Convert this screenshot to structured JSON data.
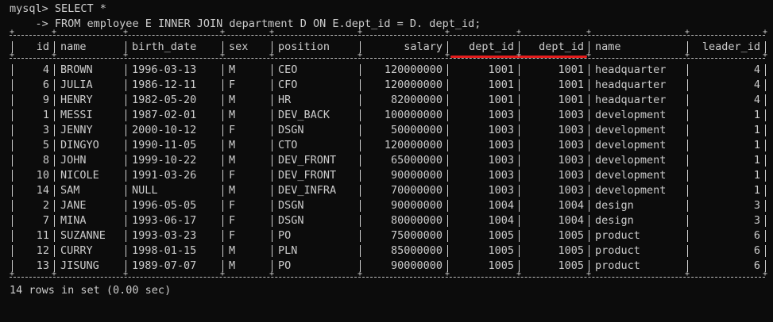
{
  "terminal": {
    "prompt": "mysql> ",
    "command_line1": "SELECT *",
    "continuation": "    -> ",
    "command_line2": "FROM employee E INNER JOIN department D ON E.dept_id = D. dept_id;",
    "summary": "14 rows in set (0.00 sec)",
    "highlight_color": "#e21d1d"
  },
  "table": {
    "headers": [
      "id",
      "name",
      "birth_date",
      "sex",
      "position",
      "salary",
      "dept_id",
      "dept_id",
      "name",
      "leader_id"
    ],
    "rows": [
      [
        "4",
        "BROWN",
        "1996-03-13",
        "M",
        "CEO",
        "120000000",
        "1001",
        "1001",
        "headquarter",
        "4"
      ],
      [
        "6",
        "JULIA",
        "1986-12-11",
        "F",
        "CFO",
        "120000000",
        "1001",
        "1001",
        "headquarter",
        "4"
      ],
      [
        "9",
        "HENRY",
        "1982-05-20",
        "M",
        "HR",
        "82000000",
        "1001",
        "1001",
        "headquarter",
        "4"
      ],
      [
        "1",
        "MESSI",
        "1987-02-01",
        "M",
        "DEV_BACK",
        "100000000",
        "1003",
        "1003",
        "development",
        "1"
      ],
      [
        "3",
        "JENNY",
        "2000-10-12",
        "F",
        "DSGN",
        "50000000",
        "1003",
        "1003",
        "development",
        "1"
      ],
      [
        "5",
        "DINGYO",
        "1990-11-05",
        "M",
        "CTO",
        "120000000",
        "1003",
        "1003",
        "development",
        "1"
      ],
      [
        "8",
        "JOHN",
        "1999-10-22",
        "M",
        "DEV_FRONT",
        "65000000",
        "1003",
        "1003",
        "development",
        "1"
      ],
      [
        "10",
        "NICOLE",
        "1991-03-26",
        "F",
        "DEV_FRONT",
        "90000000",
        "1003",
        "1003",
        "development",
        "1"
      ],
      [
        "14",
        "SAM",
        "NULL",
        "M",
        "DEV_INFRA",
        "70000000",
        "1003",
        "1003",
        "development",
        "1"
      ],
      [
        "2",
        "JANE",
        "1996-05-05",
        "F",
        "DSGN",
        "90000000",
        "1004",
        "1004",
        "design",
        "3"
      ],
      [
        "7",
        "MINA",
        "1993-06-17",
        "F",
        "DSGN",
        "80000000",
        "1004",
        "1004",
        "design",
        "3"
      ],
      [
        "11",
        "SUZANNE",
        "1993-03-23",
        "F",
        "PO",
        "75000000",
        "1005",
        "1005",
        "product",
        "6"
      ],
      [
        "12",
        "CURRY",
        "1998-01-15",
        "M",
        "PLN",
        "85000000",
        "1005",
        "1005",
        "product",
        "6"
      ],
      [
        "13",
        "JISUNG",
        "1989-07-07",
        "M",
        "PO",
        "90000000",
        "1005",
        "1005",
        "product",
        "6"
      ]
    ]
  }
}
